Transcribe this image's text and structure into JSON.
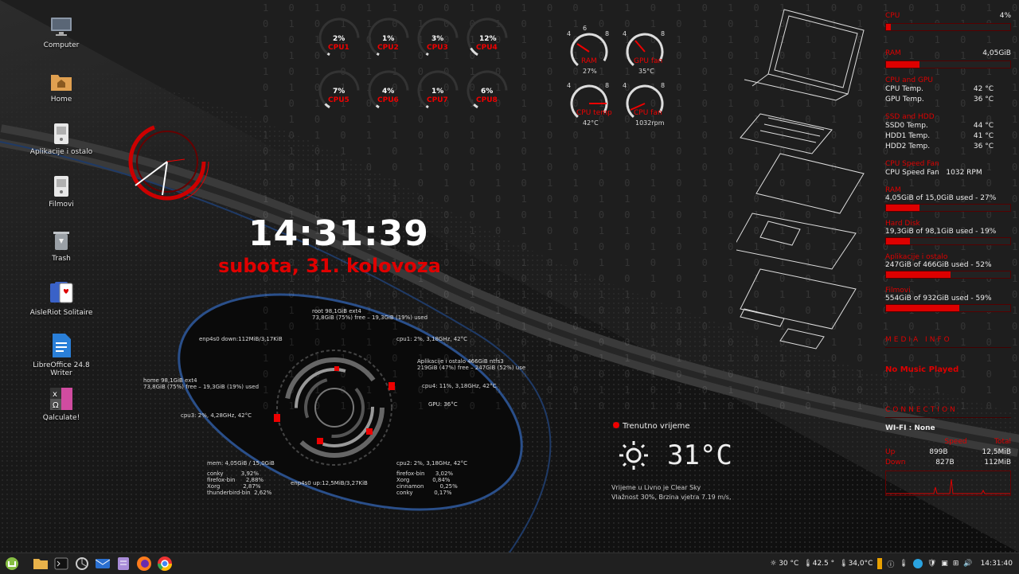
{
  "desktop_icons": [
    {
      "label": "Computer",
      "icon": "computer-icon"
    },
    {
      "label": "Home",
      "icon": "home-folder-icon"
    },
    {
      "label": "Aplikacije i ostalo",
      "icon": "drive-icon"
    },
    {
      "label": "Filmovi",
      "icon": "drive-icon"
    },
    {
      "label": "Trash",
      "icon": "trash-icon"
    },
    {
      "label": "AisleRiot Solitaire",
      "icon": "cards-icon"
    },
    {
      "label": "LibreOffice 24.8 Writer",
      "icon": "writer-icon"
    },
    {
      "label": "Qalculate!",
      "icon": "calculator-icon"
    }
  ],
  "cpu_cores": [
    {
      "label": "CPU1",
      "pct": "2%",
      "value": 2
    },
    {
      "label": "CPU2",
      "pct": "1%",
      "value": 1
    },
    {
      "label": "CPU3",
      "pct": "3%",
      "value": 3
    },
    {
      "label": "CPU4",
      "pct": "12%",
      "value": 12
    },
    {
      "label": "CPU5",
      "pct": "7%",
      "value": 7
    },
    {
      "label": "CPU6",
      "pct": "4%",
      "value": 4
    },
    {
      "label": "CPU7",
      "pct": "1%",
      "value": 1
    },
    {
      "label": "CPU8",
      "pct": "6%",
      "value": 6
    }
  ],
  "gauges": [
    {
      "label": "RAM",
      "value": "27%"
    },
    {
      "label": "GPU fan",
      "value": "35°C"
    },
    {
      "label": "CPU temp",
      "value": "42°C"
    },
    {
      "label": "CPU fan",
      "value": "1032rpm"
    }
  ],
  "gauge_ticks": [
    "1",
    "2",
    "3",
    "4",
    "5",
    "6",
    "7",
    "8",
    "9",
    "10"
  ],
  "clock": {
    "time": "14:31:39",
    "date": "subota, 31. kolovoza"
  },
  "hud": {
    "root": "root 98,1GiB ext4\n73,8GiB (75%) free – 19,3GiB (19%) used",
    "enp_down": "enp4s0 down:112MiB/3,17KiB",
    "cpu1": "cpu1: 2%, 3,18GHz, 42°C",
    "aplik": "Aplikacije i ostalo 466GiB ntfs3\n219GiB (47%) free – 247GiB (52%) use",
    "home": "home 98,1GiB ext4\n73,8GiB (75%) free – 19,3GiB (19%) used",
    "cpu4": "cpu4: 11%, 3,18GHz, 42°C",
    "gpu": "GPU: 36°C",
    "cpu3": "cpu3: 2%, 4,28GHz, 42°C",
    "cpu2": "cpu2: 2%, 3,18GHz, 42°C",
    "mem": "mem: 4,05GiB / 15,0GiB",
    "procs_left": "conky          3,92%\nfirefox-bin      2,88%\nXorg             2,87%\nthunderbird-bin  2,62%",
    "enp_up": "enp4s0 up:12,5MiB/3,27KiB",
    "procs_right": "firefox-bin      3,02%\nXorg             0,84%\ncinnamon         0,25%\nconky            0,17%"
  },
  "weather": {
    "heading": "Trenutno vrijeme",
    "temp": "31°C",
    "line1": "Vrijeme u Livno je Clear Sky",
    "line2": "Vlažnost 30%,  Brzina vjetra 7.19 m/s,"
  },
  "panel": {
    "cpu": {
      "label": "CPU",
      "value": "4%",
      "fill": 0.04
    },
    "ram": {
      "label": "RAM",
      "value": "4,05GiB",
      "fill": 0.27
    },
    "cpu_gpu_title": "CPU and GPU",
    "cpu_temp": {
      "label": "CPU Temp.",
      "value": "42 °C"
    },
    "gpu_temp": {
      "label": "GPU Temp.",
      "value": "36 °C"
    },
    "ssd_hdd_title": "SSD and HDD",
    "ssd0": {
      "label": "SSD0 Temp.",
      "value": "44 °C"
    },
    "hdd1": {
      "label": "HDD1 Temp.",
      "value": "41 °C"
    },
    "hdd2": {
      "label": "HDD2 Temp.",
      "value": "36 °C"
    },
    "fan_title": "CPU Speed Fan",
    "fan": {
      "label": "CPU Speed Fan",
      "value": "1032  RPM"
    },
    "ram2_title": "RAM",
    "ram2": {
      "text": "4,05GiB of 15,0GiB used - 27%",
      "fill": 0.27
    },
    "hd_title": "Hard Disk",
    "hd": {
      "text": "19,3GiB of 98,1GiB used - 19%",
      "fill": 0.19
    },
    "apl_title": "Aplikacije i ostalo",
    "apl": {
      "text": "247GiB of 466GiB used - 52%",
      "fill": 0.52
    },
    "film_title": "Filmovi",
    "film": {
      "text": "554GiB of 932GiB used - 59%",
      "fill": 0.59
    },
    "media_title": "MEDIA INFO",
    "media_status": "No Music Played",
    "conn_title": "CONNECTION",
    "wifi": "WI-FI : None",
    "speed_h": "Speed",
    "total_h": "Total",
    "up": {
      "label": "Up",
      "speed": "899B",
      "total": "12,5MiB"
    },
    "down": {
      "label": "Down",
      "speed": "827B",
      "total": "112MiB"
    }
  },
  "taskbar": {
    "apps": [
      "mint-menu-icon",
      "folder-icon",
      "terminal-icon",
      "system-icon",
      "mail-icon",
      "notes-icon",
      "firefox-icon",
      "chrome-icon"
    ],
    "tray_temp1": "30 °C",
    "tray_temp2": "42.5 °",
    "tray_temp3": "34,0°C",
    "time": "14:31:40"
  },
  "colors": {
    "accent": "#e00000",
    "background": "#141414",
    "panel_text": "#eeeeee"
  }
}
